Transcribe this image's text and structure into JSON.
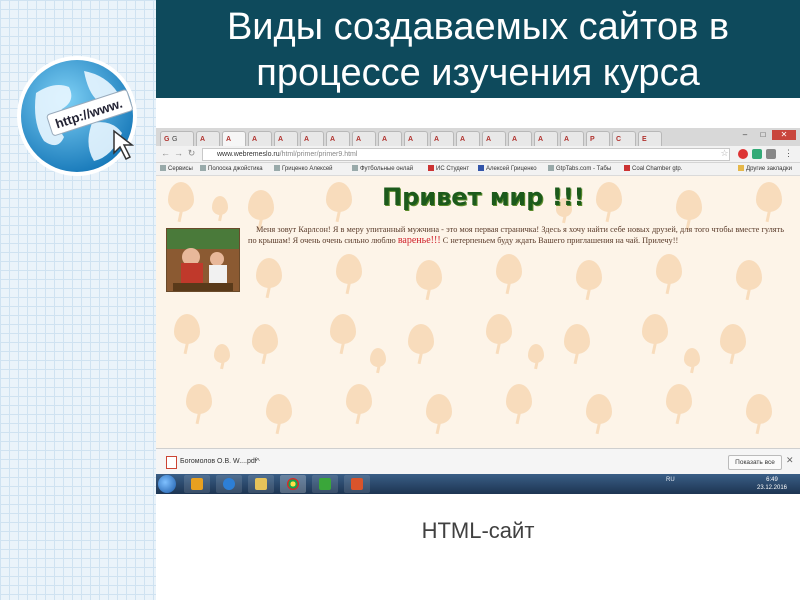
{
  "slide": {
    "title": "Виды создаваемых сайтов в процессе изучения курса",
    "caption": "HTML-сайт",
    "logo_text": "http://www."
  },
  "browser": {
    "tabs": [
      {
        "icon": "G",
        "label": "G"
      },
      {
        "icon": "A",
        "label": "A"
      },
      {
        "icon": "A",
        "label": "A"
      },
      {
        "icon": "A",
        "label": "A"
      },
      {
        "icon": "A",
        "label": "A"
      },
      {
        "icon": "A",
        "label": "A"
      },
      {
        "icon": "A",
        "label": "A"
      },
      {
        "icon": "A",
        "label": "A"
      },
      {
        "icon": "A",
        "label": "A"
      },
      {
        "icon": "A",
        "label": "A"
      },
      {
        "icon": "A",
        "label": "A"
      },
      {
        "icon": "A",
        "label": "A"
      },
      {
        "icon": "A",
        "label": "A"
      },
      {
        "icon": "A",
        "label": "A"
      },
      {
        "icon": "A",
        "label": "A"
      },
      {
        "icon": "A",
        "label": "A"
      },
      {
        "icon": "P",
        "label": "P"
      },
      {
        "icon": "C",
        "label": "C"
      },
      {
        "icon": "E",
        "label": "E"
      }
    ],
    "window_controls": [
      "–",
      "□",
      "✕"
    ],
    "url_domain": "www.webremeslo.ru",
    "url_path": "/html/primer/primer9.html",
    "bookmarks": [
      "Сервисы",
      "Полоска джойстика",
      "Гриценко Алексей",
      "Футбольные онлай",
      "ИС Студент",
      "Алексей Гриценко",
      "GtpTabs.com - Табы",
      "Coal Chamber gtp.",
      "Другие закладки"
    ],
    "page": {
      "heading": "Привет мир !!!",
      "paragraph_part1": "Меня зовут Карлсон! Я в меру упитанный мужчина - это моя первая страничка! Здесь я хочу найти себе новых друзей, для того чтобы вместе гулять по крышам! Я очень очень сильно люблю ",
      "paragraph_highlight": "варенье!!!",
      "paragraph_part2": " С нетерпеньем буду ждать Вашего приглашения на чай. Прилечу!!"
    },
    "download": {
      "file_name": "Богомолов О.В. W....pdf",
      "show_all": "Показать все",
      "close": "✕",
      "menu": "^"
    },
    "taskbar": {
      "tray_lang": "RU",
      "time": "6:49",
      "date": "23.12.2016"
    }
  },
  "colors": {
    "title_bar": "#0e4a5c",
    "page_background": "#fdf4e8",
    "heading_green": "#1c5a1c",
    "highlight_red": "#d0212b"
  }
}
